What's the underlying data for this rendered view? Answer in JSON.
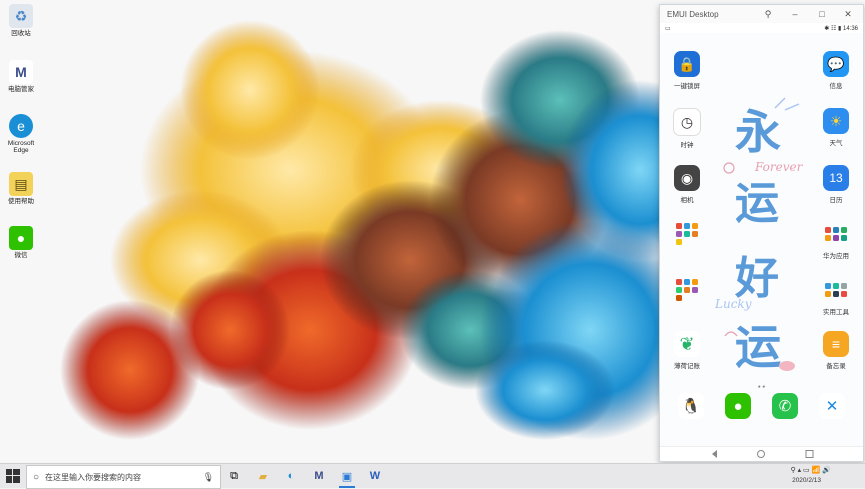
{
  "desktop": {
    "icons": [
      {
        "label": "回收站"
      },
      {
        "label": "电脑管家"
      },
      {
        "label": "Microsoft Edge"
      },
      {
        "label": "使用帮助"
      },
      {
        "label": "微信"
      }
    ]
  },
  "emui_window": {
    "title": "EMUI Desktop",
    "status_time": "14:36",
    "apps_left": [
      {
        "label": "一键锁屏"
      },
      {
        "label": "时钟"
      },
      {
        "label": "相机"
      },
      {
        "label": ""
      },
      {
        "label": ""
      },
      {
        "label": "薄荷记账"
      }
    ],
    "apps_right": [
      {
        "label": "信息"
      },
      {
        "label": "天气"
      },
      {
        "label": "日历",
        "date": "13"
      },
      {
        "label": "华为应用"
      },
      {
        "label": "实用工具"
      },
      {
        "label": "备忘录"
      }
    ],
    "calligraphy": [
      "永",
      "运",
      "好",
      "运"
    ],
    "calligraphy_en": [
      "Forever",
      "Lucky"
    ],
    "dock": [
      "qq-icon",
      "wechat-icon",
      "phone-icon",
      "x-icon"
    ]
  },
  "taskbar": {
    "search_placeholder": "在这里输入你要搜索的内容",
    "date": "2020/2/13",
    "accent": "#2b7bd6"
  }
}
